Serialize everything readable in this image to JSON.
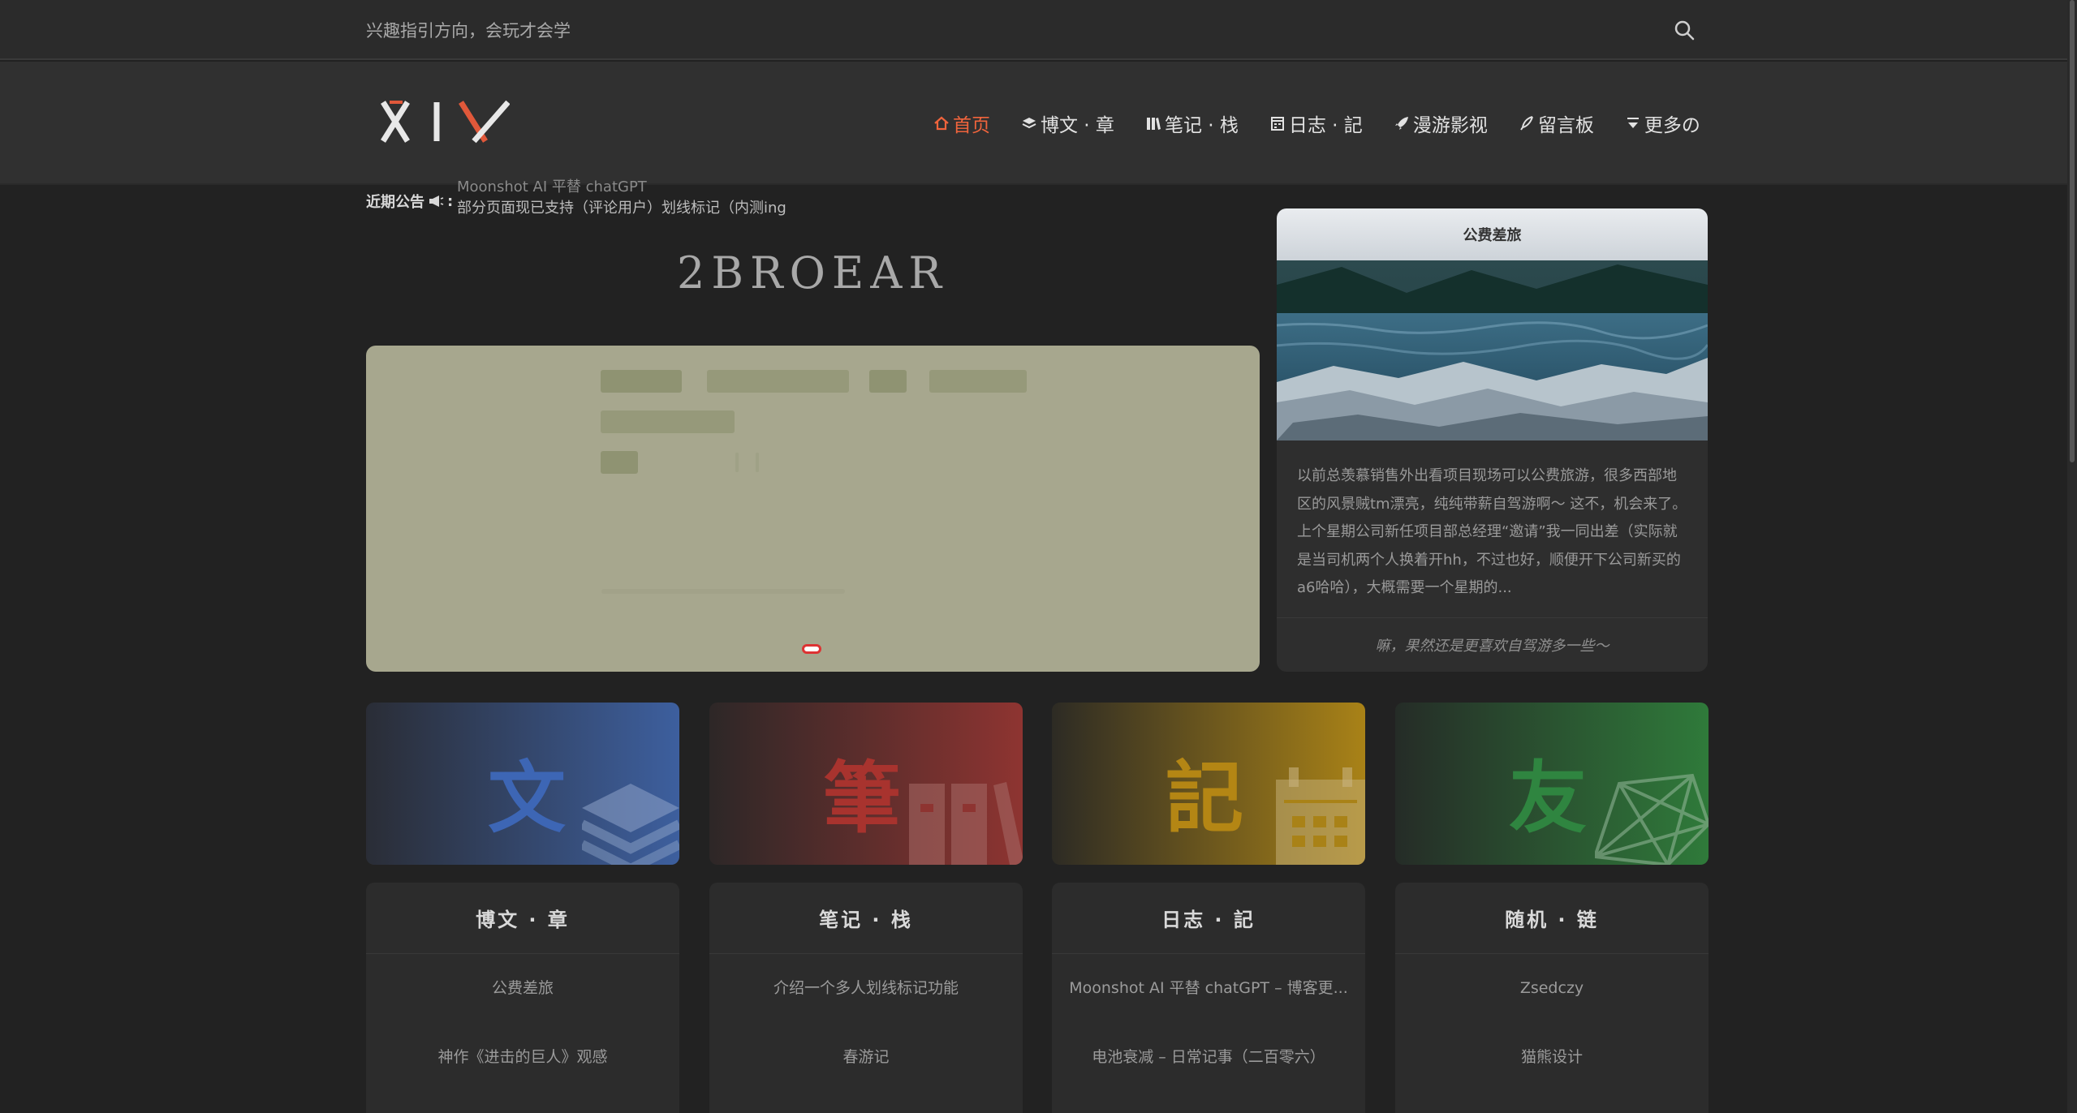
{
  "topbar": {
    "tagline": "兴趣指引方向，会玩才会学"
  },
  "logo": {
    "text": "XIY"
  },
  "nav": {
    "items": [
      {
        "label": "首页",
        "icon": "home-icon"
      },
      {
        "label": "博文 · 章",
        "icon": "layers-icon"
      },
      {
        "label": "笔记 · 栈",
        "icon": "books-icon"
      },
      {
        "label": "日志 · 記",
        "icon": "calendar-icon"
      },
      {
        "label": "漫游影视",
        "icon": "rocket-icon"
      },
      {
        "label": "留言板",
        "icon": "feather-icon"
      },
      {
        "label": "更多の",
        "icon": "sort-down-icon"
      }
    ]
  },
  "announcement": {
    "label": "近期公告",
    "prev_text": "Moonshot AI 平替 chatGPT",
    "text": "部分页面现已支持（评论用户）划线标记（内测ing"
  },
  "site_title": "2BROEAR",
  "featured": {
    "title": "公费差旅",
    "excerpt": "以前总羡慕销售外出看项目现场可以公费旅游，很多西部地区的风景贼tm漂亮，纯纯带薪自驾游啊～ 这不，机会来了。上个星期公司新任项目部总经理“邀请”我一同出差（实际就是当司机两个人换着开hh，不过也好，顺便开下公司新买的a6哈哈），大概需要一个星期的...",
    "footer": "嘛，果然还是更喜欢自驾游多一些～"
  },
  "tiles": [
    {
      "char": "文",
      "color": "#3d5f9e"
    },
    {
      "char": "筆",
      "color": "#8e3431"
    },
    {
      "char": "記",
      "color": "#a98217"
    },
    {
      "char": "友",
      "color": "#2f7a3a"
    }
  ],
  "lists": [
    {
      "title": "博文 · 章",
      "items": [
        "公费差旅",
        "神作《进击的巨人》观感"
      ]
    },
    {
      "title": "笔记 · 栈",
      "items": [
        "介绍一个多人划线标记功能",
        "春游记"
      ]
    },
    {
      "title": "日志 · 記",
      "items": [
        "Moonshot AI 平替 chatGPT – 博客更...",
        "电池衰减 – 日常记事（二百零六）"
      ]
    },
    {
      "title": "随机 · 链",
      "items": [
        "Zsedczy",
        "猫熊设计"
      ]
    }
  ]
}
